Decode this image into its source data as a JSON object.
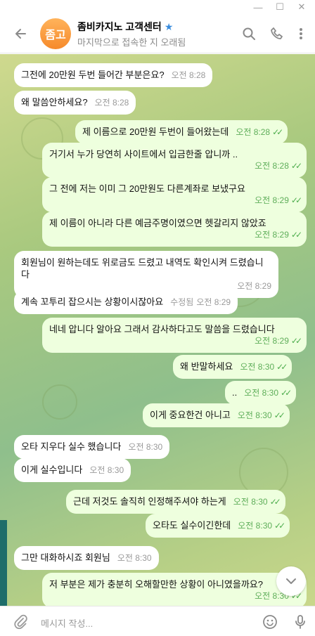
{
  "window": {
    "min_label": "—",
    "max_label": "☐",
    "close_label": "✕"
  },
  "header": {
    "avatar_text": "좀고",
    "chat_name": "좀비카지노 고객센터",
    "verified_icon": "star-icon",
    "status": "마지막으로 접속한 지 오래됨",
    "icons": [
      "back-arrow-icon",
      "search-icon",
      "phone-icon",
      "more-vertical-icon"
    ]
  },
  "messages": [
    {
      "dir": "in",
      "text": "그전에 20만원 두번 들어간 부분은요?",
      "time": "오전 8:28"
    },
    {
      "dir": "in",
      "text": "왜 말씀안하세요?",
      "time": "오전 8:28"
    },
    {
      "dir": "out",
      "text": "제 이름으로 20만원 두번이 들어왔는데",
      "time": "오전 8:28"
    },
    {
      "dir": "out",
      "text": "거기서 누가 당연히 사이트에서 입금한줄 압니까 ..",
      "time": "오전 8:28"
    },
    {
      "dir": "out",
      "text": "그 전에 저는 이미 그 20만원도 다른계좌로 보냈구요",
      "time": "오전 8:29"
    },
    {
      "dir": "out",
      "text": "제 이름이 아니라 다른 예금주명이였으면 헷갈리지 않았죠",
      "time": "오전 8:29"
    },
    {
      "dir": "in",
      "text": "회원님이 원하는데도 위로금도 드렸고 내역도 확인시켜 드렸습니다",
      "time": "오전 8:29"
    },
    {
      "dir": "in",
      "text": "계속 꼬투리 잡으시는 상황이시잖아요",
      "edited": "수정됨",
      "time": "오전 8:29"
    },
    {
      "dir": "out",
      "text": "네네 압니다 알아요 그래서 감사하다고도 말씀을 드렸습니다",
      "time": "오전 8:29"
    },
    {
      "dir": "out",
      "text": "왜 반말하세요",
      "time": "오전 8:30"
    },
    {
      "dir": "out",
      "text": "..",
      "time": "오전 8:30"
    },
    {
      "dir": "out",
      "text": "이게 중요한건 아니고",
      "time": "오전 8:30"
    },
    {
      "dir": "in",
      "text": "오타 지우다 실수 했습니다",
      "time": "오전 8:30"
    },
    {
      "dir": "in",
      "text": "이게 실수입니다",
      "time": "오전 8:30"
    },
    {
      "dir": "out",
      "text": "근데 저것도 솔직히 인정해주셔야 하는게",
      "time": "오전 8:30"
    },
    {
      "dir": "out",
      "text": "오타도 실수이긴한데",
      "time": "오전 8:30"
    },
    {
      "dir": "in",
      "text": "그만 대화하시죠 회원님",
      "time": "오전 8:30"
    },
    {
      "dir": "out",
      "text": "저 부분은 제가 충분히 오해할만한 상황이 아니였을까요?",
      "time": "오전 8:30"
    }
  ],
  "composer": {
    "placeholder": "메시지 작성...",
    "icons": [
      "attach-icon",
      "emoji-icon",
      "microphone-icon"
    ]
  },
  "colors": {
    "incoming_bubble": "#ffffff",
    "outgoing_bubble": "#eeffde",
    "check_color": "#4fae4e",
    "avatar_orange": "#f68a2b",
    "verified_blue": "#3a8dde"
  }
}
